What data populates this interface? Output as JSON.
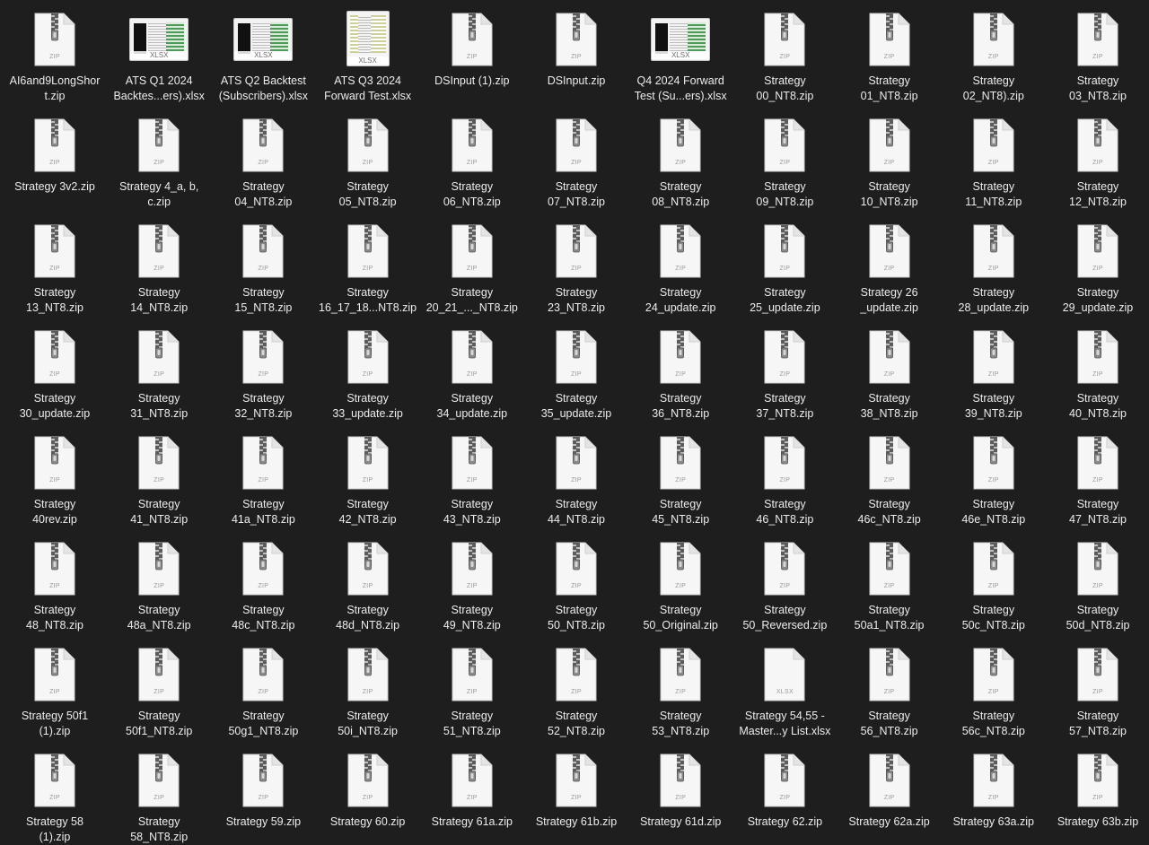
{
  "files": [
    {
      "name": "AI6and9LongShor\nt.zip",
      "type": "zip"
    },
    {
      "name": "ATS Q1 2024\nBacktes...ers).xlsx",
      "type": "xlsx-thumb"
    },
    {
      "name": "ATS Q2 Backtest\n(Subscribers).xlsx",
      "type": "xlsx-thumb"
    },
    {
      "name": "ATS Q3 2024\nForward Test.xlsx",
      "type": "xlsx-thumb-tall"
    },
    {
      "name": "DSInput (1).zip",
      "type": "zip"
    },
    {
      "name": "DSInput.zip",
      "type": "zip"
    },
    {
      "name": "Q4 2024 Forward\nTest (Su...ers).xlsx",
      "type": "xlsx-thumb"
    },
    {
      "name": "Strategy\n00_NT8.zip",
      "type": "zip"
    },
    {
      "name": "Strategy\n01_NT8.zip",
      "type": "zip"
    },
    {
      "name": "Strategy\n02_NT8).zip",
      "type": "zip"
    },
    {
      "name": "Strategy\n03_NT8.zip",
      "type": "zip"
    },
    {
      "name": "Strategy 3v2.zip",
      "type": "zip"
    },
    {
      "name": "Strategy 4_a, b,\nc.zip",
      "type": "zip"
    },
    {
      "name": "Strategy\n04_NT8.zip",
      "type": "zip"
    },
    {
      "name": "Strategy\n05_NT8.zip",
      "type": "zip"
    },
    {
      "name": "Strategy\n06_NT8.zip",
      "type": "zip"
    },
    {
      "name": "Strategy\n07_NT8.zip",
      "type": "zip"
    },
    {
      "name": "Strategy\n08_NT8.zip",
      "type": "zip"
    },
    {
      "name": "Strategy\n09_NT8.zip",
      "type": "zip"
    },
    {
      "name": "Strategy\n10_NT8.zip",
      "type": "zip"
    },
    {
      "name": "Strategy\n11_NT8.zip",
      "type": "zip"
    },
    {
      "name": "Strategy\n12_NT8.zip",
      "type": "zip"
    },
    {
      "name": "Strategy\n13_NT8.zip",
      "type": "zip"
    },
    {
      "name": "Strategy\n14_NT8.zip",
      "type": "zip"
    },
    {
      "name": "Strategy\n15_NT8.zip",
      "type": "zip"
    },
    {
      "name": "Strategy\n16_17_18...NT8.zip",
      "type": "zip"
    },
    {
      "name": "Strategy\n20_21_..._NT8.zip",
      "type": "zip"
    },
    {
      "name": "Strategy\n23_NT8.zip",
      "type": "zip"
    },
    {
      "name": "Strategy\n24_update.zip",
      "type": "zip"
    },
    {
      "name": "Strategy\n25_update.zip",
      "type": "zip"
    },
    {
      "name": "Strategy 26\n_update.zip",
      "type": "zip"
    },
    {
      "name": "Strategy\n28_update.zip",
      "type": "zip"
    },
    {
      "name": "Strategy\n29_update.zip",
      "type": "zip"
    },
    {
      "name": "Strategy\n30_update.zip",
      "type": "zip"
    },
    {
      "name": "Strategy\n31_NT8.zip",
      "type": "zip"
    },
    {
      "name": "Strategy\n32_NT8.zip",
      "type": "zip"
    },
    {
      "name": "Strategy\n33_update.zip",
      "type": "zip"
    },
    {
      "name": "Strategy\n34_update.zip",
      "type": "zip"
    },
    {
      "name": "Strategy\n35_update.zip",
      "type": "zip"
    },
    {
      "name": "Strategy\n36_NT8.zip",
      "type": "zip"
    },
    {
      "name": "Strategy\n37_NT8.zip",
      "type": "zip"
    },
    {
      "name": "Strategy\n38_NT8.zip",
      "type": "zip"
    },
    {
      "name": "Strategy\n39_NT8.zip",
      "type": "zip"
    },
    {
      "name": "Strategy\n40_NT8.zip",
      "type": "zip"
    },
    {
      "name": "Strategy\n40rev.zip",
      "type": "zip"
    },
    {
      "name": "Strategy\n41_NT8.zip",
      "type": "zip"
    },
    {
      "name": "Strategy\n41a_NT8.zip",
      "type": "zip"
    },
    {
      "name": "Strategy\n42_NT8.zip",
      "type": "zip"
    },
    {
      "name": "Strategy\n43_NT8.zip",
      "type": "zip"
    },
    {
      "name": "Strategy\n44_NT8.zip",
      "type": "zip"
    },
    {
      "name": "Strategy\n45_NT8.zip",
      "type": "zip"
    },
    {
      "name": "Strategy\n46_NT8.zip",
      "type": "zip"
    },
    {
      "name": "Strategy\n46c_NT8.zip",
      "type": "zip"
    },
    {
      "name": "Strategy\n46e_NT8.zip",
      "type": "zip"
    },
    {
      "name": "Strategy\n47_NT8.zip",
      "type": "zip"
    },
    {
      "name": "Strategy\n48_NT8.zip",
      "type": "zip"
    },
    {
      "name": "Strategy\n48a_NT8.zip",
      "type": "zip"
    },
    {
      "name": "Strategy\n48c_NT8.zip",
      "type": "zip"
    },
    {
      "name": "Strategy\n48d_NT8.zip",
      "type": "zip"
    },
    {
      "name": "Strategy\n49_NT8.zip",
      "type": "zip"
    },
    {
      "name": "Strategy\n50_NT8.zip",
      "type": "zip"
    },
    {
      "name": "Strategy\n50_Original.zip",
      "type": "zip"
    },
    {
      "name": "Strategy\n50_Reversed.zip",
      "type": "zip"
    },
    {
      "name": "Strategy\n50a1_NT8.zip",
      "type": "zip"
    },
    {
      "name": "Strategy\n50c_NT8.zip",
      "type": "zip"
    },
    {
      "name": "Strategy\n50d_NT8.zip",
      "type": "zip"
    },
    {
      "name": "Strategy 50f1\n(1).zip",
      "type": "zip"
    },
    {
      "name": "Strategy\n50f1_NT8.zip",
      "type": "zip"
    },
    {
      "name": "Strategy\n50g1_NT8.zip",
      "type": "zip"
    },
    {
      "name": "Strategy\n50i_NT8.zip",
      "type": "zip"
    },
    {
      "name": "Strategy\n51_NT8.zip",
      "type": "zip"
    },
    {
      "name": "Strategy\n52_NT8.zip",
      "type": "zip"
    },
    {
      "name": "Strategy\n53_NT8.zip",
      "type": "zip"
    },
    {
      "name": "Strategy 54,55 -\nMaster...y List.xlsx",
      "type": "xlsx"
    },
    {
      "name": "Strategy\n56_NT8.zip",
      "type": "zip"
    },
    {
      "name": "Strategy\n56c_NT8.zip",
      "type": "zip"
    },
    {
      "name": "Strategy\n57_NT8.zip",
      "type": "zip"
    },
    {
      "name": "Strategy 58\n(1).zip",
      "type": "zip"
    },
    {
      "name": "Strategy\n58_NT8.zip",
      "type": "zip"
    },
    {
      "name": "Strategy 59.zip",
      "type": "zip"
    },
    {
      "name": "Strategy 60.zip",
      "type": "zip"
    },
    {
      "name": "Strategy 61a.zip",
      "type": "zip"
    },
    {
      "name": "Strategy 61b.zip",
      "type": "zip"
    },
    {
      "name": "Strategy 61d.zip",
      "type": "zip"
    },
    {
      "name": "Strategy 62.zip",
      "type": "zip"
    },
    {
      "name": "Strategy 62a.zip",
      "type": "zip"
    },
    {
      "name": "Strategy 63a.zip",
      "type": "zip"
    },
    {
      "name": "Strategy 63b.zip",
      "type": "zip"
    }
  ],
  "type_labels": {
    "zip": "ZIP",
    "xlsx": "XLSX"
  },
  "colors": {
    "background": "#1e1e1e",
    "label": "#ececec",
    "doc": "#f5f5f5",
    "zipper": "#6e6e6e"
  }
}
